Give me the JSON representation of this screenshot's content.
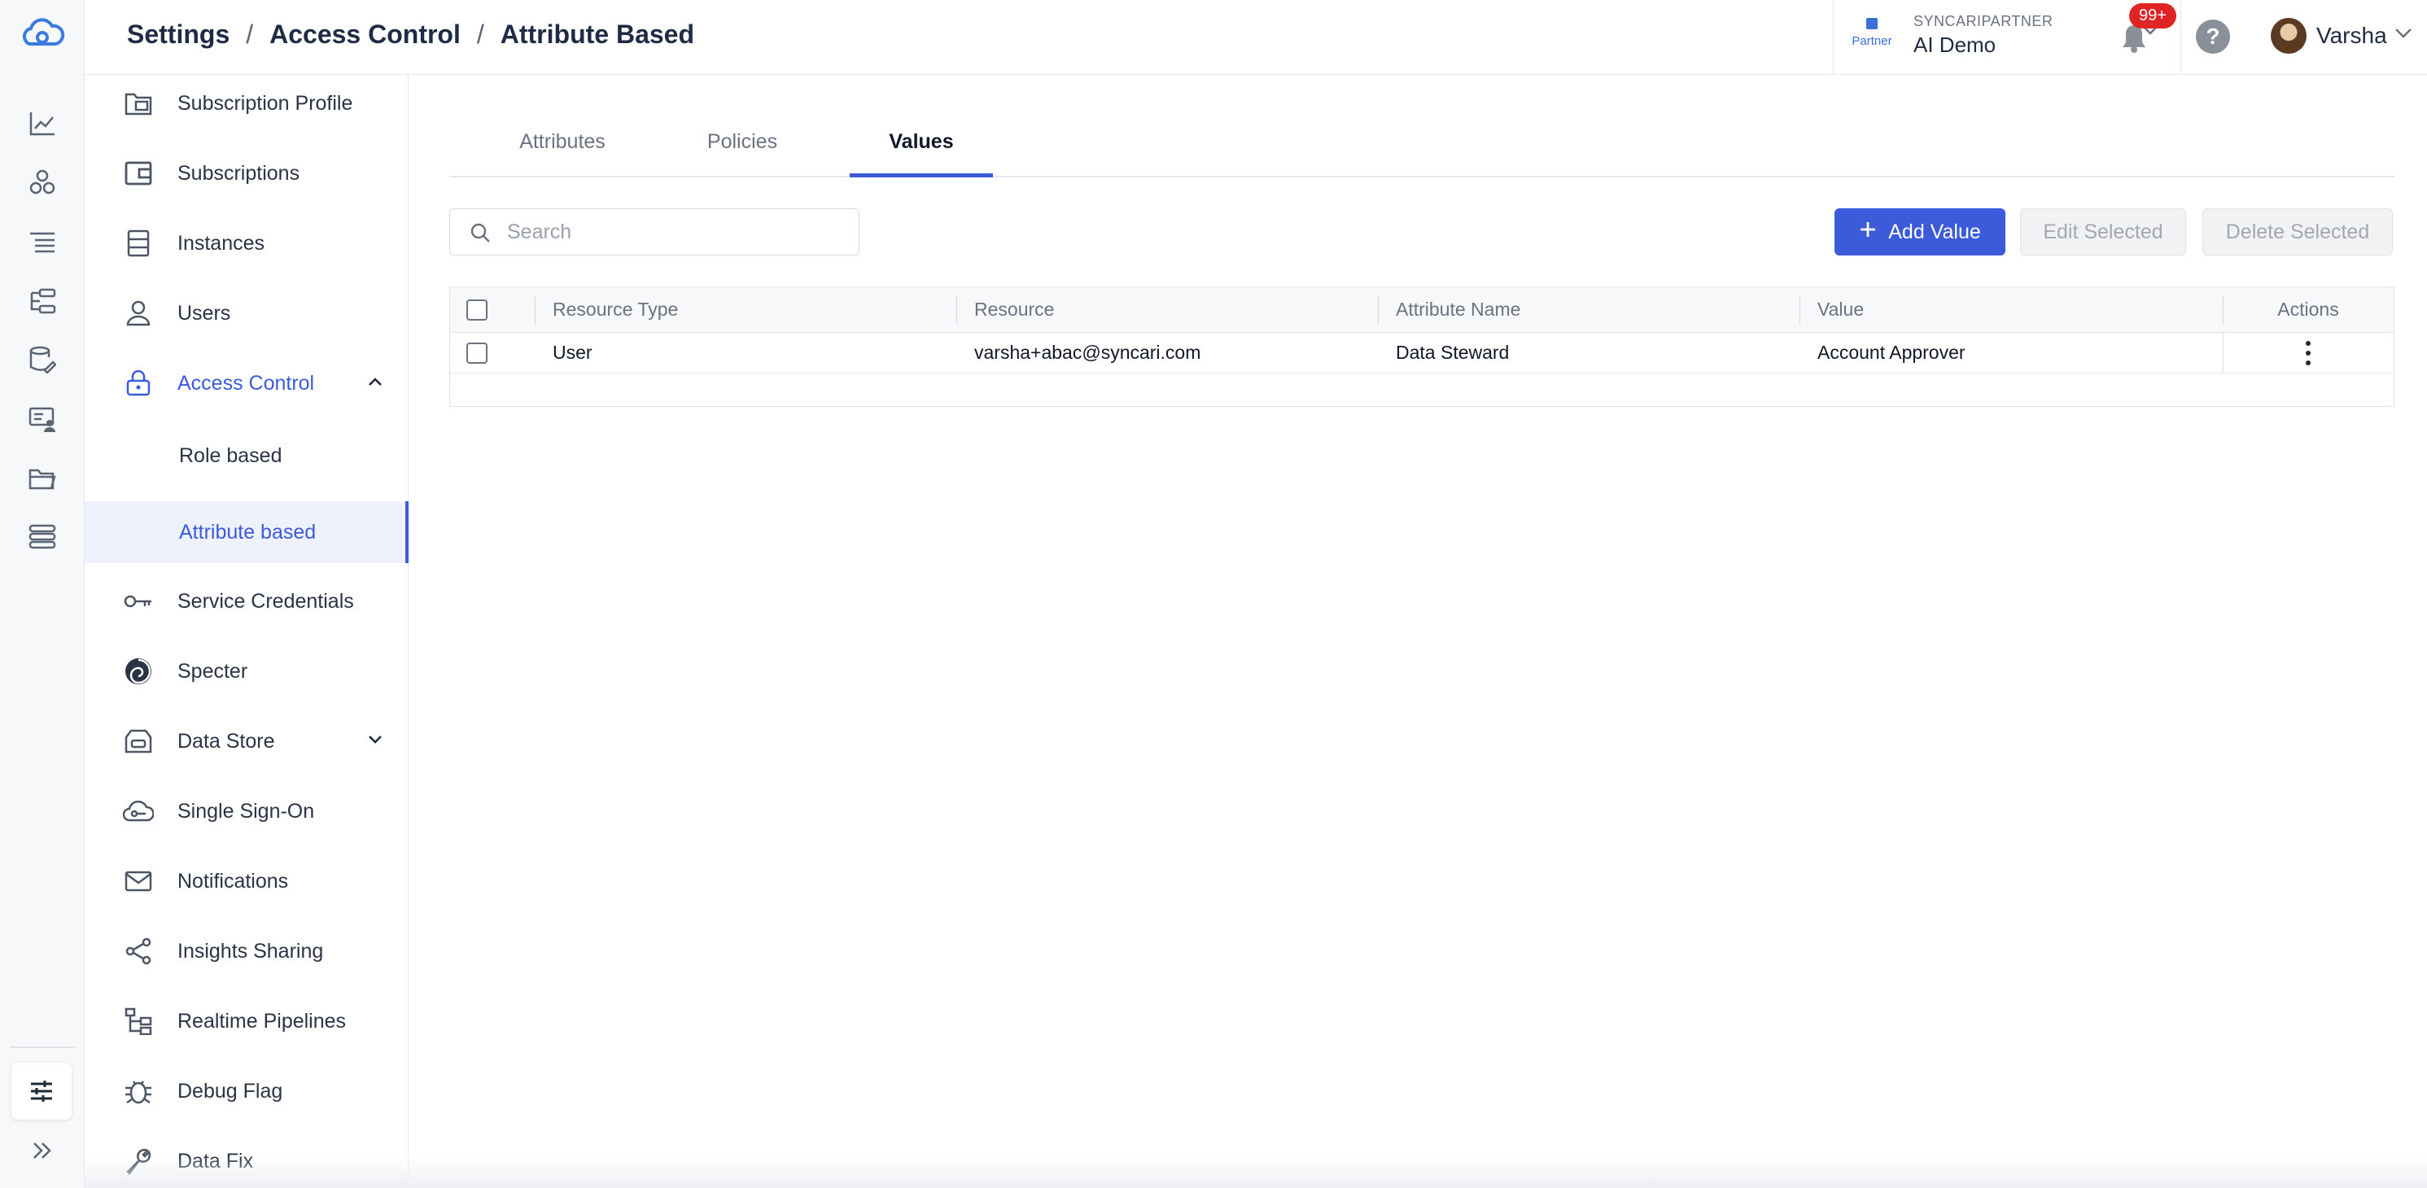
{
  "header": {
    "breadcrumb": [
      "Settings",
      "Access Control",
      "Attribute Based"
    ],
    "separator": "/",
    "org": {
      "badge_text": "Partner",
      "caption": "SYNCARIPARTNER",
      "name": "AI Demo"
    },
    "notifications_count": "99+",
    "help_glyph": "?",
    "user_name": "Varsha"
  },
  "rail": {
    "icons": [
      "cloud-logo-icon",
      "chart-icon",
      "people-icon",
      "list-icon",
      "flow-icon",
      "database-edit-icon",
      "monitor-user-icon",
      "folder-icon",
      "stack-icon",
      "sliders-icon",
      "double-chevron-right-icon"
    ]
  },
  "settings_nav": {
    "items": [
      {
        "label": "Subscription Profile",
        "icon": "id-card-icon"
      },
      {
        "label": "Subscriptions",
        "icon": "wallet-icon"
      },
      {
        "label": "Instances",
        "icon": "server-icon"
      },
      {
        "label": "Users",
        "icon": "user-icon"
      },
      {
        "label": "Access Control",
        "icon": "lock-icon",
        "expanded": true
      },
      {
        "label": "Role based"
      },
      {
        "label": "Attribute based",
        "selected": true
      },
      {
        "label": "Service Credentials",
        "icon": "key-icon"
      },
      {
        "label": "Specter",
        "icon": "specter-icon"
      },
      {
        "label": "Data Store",
        "icon": "data-store-icon",
        "expanded": false
      },
      {
        "label": "Single Sign-On",
        "icon": "cloud-key-icon"
      },
      {
        "label": "Notifications",
        "icon": "mail-icon"
      },
      {
        "label": "Insights Sharing",
        "icon": "share-icon"
      },
      {
        "label": "Realtime Pipelines",
        "icon": "pipeline-icon"
      },
      {
        "label": "Debug Flag",
        "icon": "bug-icon"
      },
      {
        "label": "Data Fix",
        "icon": "wrench-icon"
      }
    ]
  },
  "tabs": [
    {
      "label": "Attributes",
      "active": false
    },
    {
      "label": "Policies",
      "active": false
    },
    {
      "label": "Values",
      "active": true
    }
  ],
  "search": {
    "placeholder": "Search",
    "value": ""
  },
  "actions": {
    "add": "Add Value",
    "edit": "Edit Selected",
    "delete": "Delete Selected"
  },
  "table": {
    "columns": [
      "Resource Type",
      "Resource",
      "Attribute Name",
      "Value",
      "Actions"
    ],
    "rows": [
      {
        "resource_type": "User",
        "resource": "varsha+abac@syncari.com",
        "attribute_name": "Data Steward",
        "value": "Account Approver"
      }
    ]
  },
  "colors": {
    "accent": "#3b5bdb",
    "badge": "#e02424"
  }
}
